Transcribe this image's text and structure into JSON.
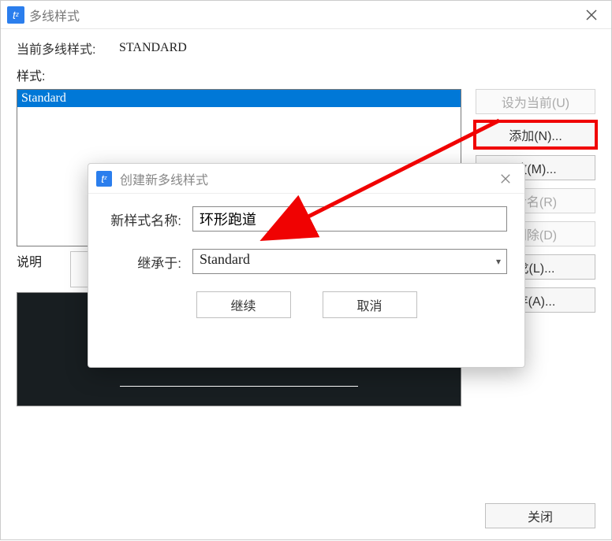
{
  "main": {
    "title": "多线样式",
    "current_label": "当前多线样式:",
    "current_value": "STANDARD",
    "styles_label": "样式:",
    "list_items": [
      "Standard"
    ],
    "desc_label": "说明",
    "buttons": {
      "set_current": "设为当前(U)",
      "add": "添加(N)...",
      "modify": "改(M)...",
      "rename": "命名(R)",
      "delete": "删除(D)",
      "load": "戈(L)...",
      "save": "存(A)..."
    },
    "close": "关闭"
  },
  "sub": {
    "title": "创建新多线样式",
    "name_label": "新样式名称:",
    "name_value": "环形跑道",
    "inherit_label": "继承于:",
    "inherit_value": "Standard",
    "continue_label": "继续",
    "cancel_label": "取消"
  },
  "annotation": {
    "arrow_color": "#f00202"
  }
}
